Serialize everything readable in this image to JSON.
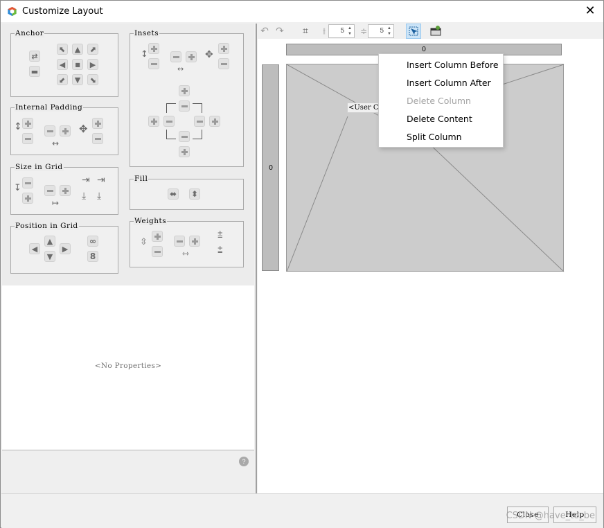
{
  "window": {
    "title": "Customize Layout",
    "close_glyph": "✕"
  },
  "left": {
    "groups": {
      "anchor": "Anchor",
      "insets": "Insets",
      "padding": "Internal Padding",
      "size": "Size in Grid",
      "fill": "Fill",
      "position": "Position in Grid",
      "weights": "Weights"
    },
    "no_properties": "<No Properties>",
    "help_glyph": "?"
  },
  "toolbar": {
    "h_gap_value": "5",
    "v_gap_value": "5"
  },
  "canvas": {
    "column_header": "0",
    "row_header": "0",
    "cell_component_label": "<User Co"
  },
  "context_menu": {
    "items": [
      {
        "label": "Insert Column Before",
        "enabled": true
      },
      {
        "label": "Insert Column After",
        "enabled": true
      },
      {
        "label": "Delete Column",
        "enabled": false
      },
      {
        "label": "Delete Content",
        "enabled": true
      },
      {
        "label": "Split Column",
        "enabled": true
      }
    ]
  },
  "buttons": {
    "close": "Close",
    "help": "Help"
  },
  "watermark": "CSDN @have_to_be",
  "colors": {
    "menu_disabled": "#a3a3a3",
    "active_tool_bg": "#cce4f7",
    "cell_bg": "#cccccc"
  }
}
